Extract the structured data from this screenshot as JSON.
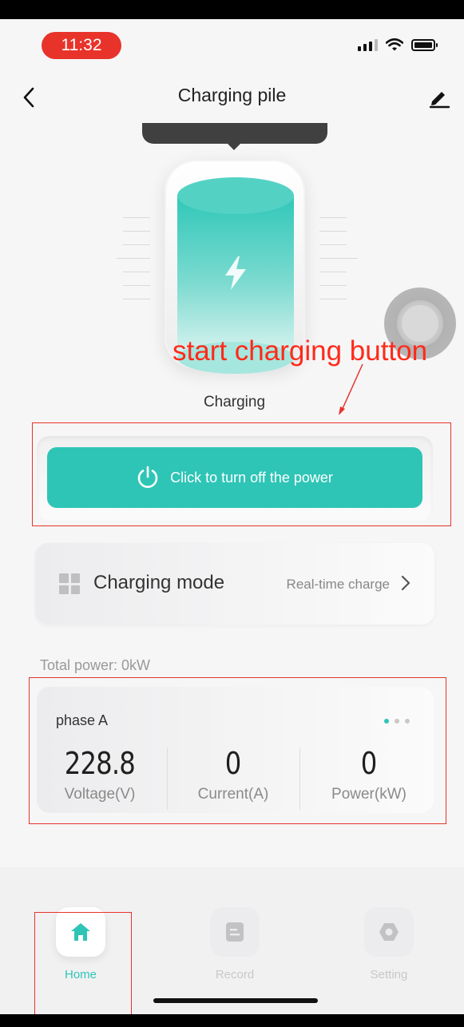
{
  "status_bar": {
    "time": "11:32"
  },
  "header": {
    "title": "Charging pile"
  },
  "charging": {
    "status": "Charging",
    "power_button_label": "Click to turn off the power"
  },
  "annotation": {
    "text": "start charging button"
  },
  "mode": {
    "label": "Charging mode",
    "value": "Real-time charge"
  },
  "total_power": "Total power:  0kW",
  "phase": {
    "title": "phase A",
    "metrics": [
      {
        "value": "228.8",
        "label": "Voltage(V)"
      },
      {
        "value": "0",
        "label": "Current(A)"
      },
      {
        "value": "0",
        "label": "Power(kW)"
      }
    ]
  },
  "nav": [
    {
      "label": "Home",
      "icon": "home-icon"
    },
    {
      "label": "Record",
      "icon": "record-icon"
    },
    {
      "label": "Setting",
      "icon": "setting-icon"
    }
  ],
  "colors": {
    "accent": "#2ec5b6",
    "annotation": "#e8332a"
  }
}
